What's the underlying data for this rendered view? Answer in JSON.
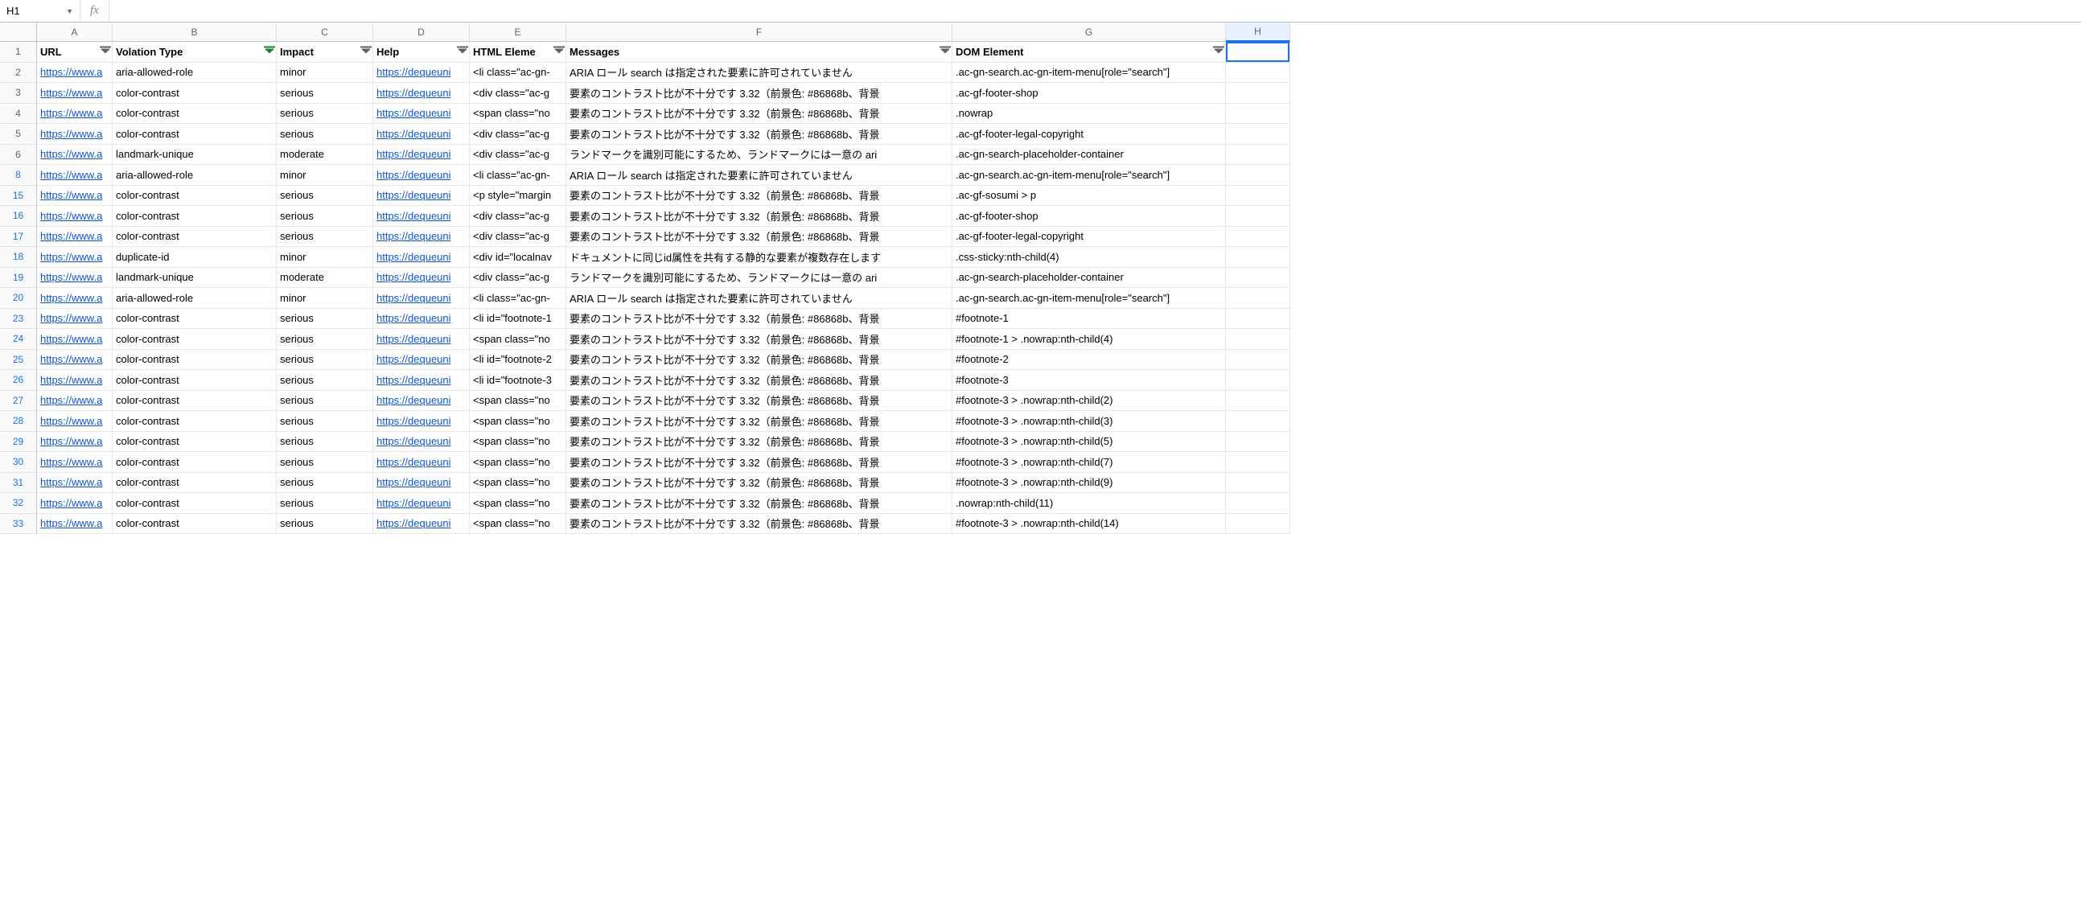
{
  "name_box": "H1",
  "fx_label": "fx",
  "columns": [
    "A",
    "B",
    "C",
    "D",
    "E",
    "F",
    "G",
    "H"
  ],
  "headers": {
    "url": "URL",
    "violation_type": "Volation Type",
    "impact": "Impact",
    "help": "Help",
    "html_element": "HTML Eleme",
    "messages": "Messages",
    "dom_element": "DOM Element"
  },
  "row_numbers": [
    "1",
    "2",
    "3",
    "4",
    "5",
    "6",
    "8",
    "15",
    "16",
    "17",
    "18",
    "19",
    "20",
    "23",
    "24",
    "25",
    "26",
    "27",
    "28",
    "29",
    "30",
    "31",
    "32",
    "33"
  ],
  "filtered_rows": [
    "8",
    "15",
    "16",
    "17",
    "18",
    "19",
    "20",
    "23",
    "24",
    "25",
    "26",
    "27",
    "28",
    "29",
    "30",
    "31",
    "32",
    "33"
  ],
  "rows": [
    {
      "url": "https://www.a",
      "type": "aria-allowed-role",
      "impact": "minor",
      "help": "https://dequeuni",
      "html": "<li class=\"ac-gn-",
      "msg": "ARIA ロール search は指定された要素に許可されていません",
      "dom": ".ac-gn-search.ac-gn-item-menu[role=\"search\"]"
    },
    {
      "url": "https://www.a",
      "type": "color-contrast",
      "impact": "serious",
      "help": "https://dequeuni",
      "html": "<div class=\"ac-g",
      "msg": "要素のコントラスト比が不十分です 3.32（前景色: #86868b、背景",
      "dom": ".ac-gf-footer-shop"
    },
    {
      "url": "https://www.a",
      "type": "color-contrast",
      "impact": "serious",
      "help": "https://dequeuni",
      "html": "<span class=\"no",
      "msg": "要素のコントラスト比が不十分です 3.32（前景色: #86868b、背景",
      "dom": ".nowrap"
    },
    {
      "url": "https://www.a",
      "type": "color-contrast",
      "impact": "serious",
      "help": "https://dequeuni",
      "html": "<div class=\"ac-g",
      "msg": "要素のコントラスト比が不十分です 3.32（前景色: #86868b、背景",
      "dom": ".ac-gf-footer-legal-copyright"
    },
    {
      "url": "https://www.a",
      "type": "landmark-unique",
      "impact": "moderate",
      "help": "https://dequeuni",
      "html": "<div class=\"ac-g",
      "msg": "ランドマークを識別可能にするため、ランドマークには一意の ari",
      "dom": ".ac-gn-search-placeholder-container"
    },
    {
      "url": "https://www.a",
      "type": "aria-allowed-role",
      "impact": "minor",
      "help": "https://dequeuni",
      "html": "<li class=\"ac-gn-",
      "msg": "ARIA ロール search は指定された要素に許可されていません",
      "dom": ".ac-gn-search.ac-gn-item-menu[role=\"search\"]"
    },
    {
      "url": "https://www.a",
      "type": "color-contrast",
      "impact": "serious",
      "help": "https://dequeuni",
      "html": "<p style=\"margin",
      "msg": "要素のコントラスト比が不十分です 3.32（前景色: #86868b、背景",
      "dom": ".ac-gf-sosumi > p"
    },
    {
      "url": "https://www.a",
      "type": "color-contrast",
      "impact": "serious",
      "help": "https://dequeuni",
      "html": "<div class=\"ac-g",
      "msg": "要素のコントラスト比が不十分です 3.32（前景色: #86868b、背景",
      "dom": ".ac-gf-footer-shop"
    },
    {
      "url": "https://www.a",
      "type": "color-contrast",
      "impact": "serious",
      "help": "https://dequeuni",
      "html": "<div class=\"ac-g",
      "msg": "要素のコントラスト比が不十分です 3.32（前景色: #86868b、背景",
      "dom": ".ac-gf-footer-legal-copyright"
    },
    {
      "url": "https://www.a",
      "type": "duplicate-id",
      "impact": "minor",
      "help": "https://dequeuni",
      "html": "<div id=\"localnav",
      "msg": "ドキュメントに同じid属性を共有する静的な要素が複数存在します",
      "dom": ".css-sticky:nth-child(4)"
    },
    {
      "url": "https://www.a",
      "type": "landmark-unique",
      "impact": "moderate",
      "help": "https://dequeuni",
      "html": "<div class=\"ac-g",
      "msg": "ランドマークを識別可能にするため、ランドマークには一意の ari",
      "dom": ".ac-gn-search-placeholder-container"
    },
    {
      "url": "https://www.a",
      "type": "aria-allowed-role",
      "impact": "minor",
      "help": "https://dequeuni",
      "html": "<li class=\"ac-gn-",
      "msg": "ARIA ロール search は指定された要素に許可されていません",
      "dom": ".ac-gn-search.ac-gn-item-menu[role=\"search\"]"
    },
    {
      "url": "https://www.a",
      "type": "color-contrast",
      "impact": "serious",
      "help": "https://dequeuni",
      "html": "<li id=\"footnote-1",
      "msg": "要素のコントラスト比が不十分です 3.32（前景色: #86868b、背景",
      "dom": "#footnote-1"
    },
    {
      "url": "https://www.a",
      "type": "color-contrast",
      "impact": "serious",
      "help": "https://dequeuni",
      "html": "<span class=\"no",
      "msg": "要素のコントラスト比が不十分です 3.32（前景色: #86868b、背景",
      "dom": "#footnote-1 > .nowrap:nth-child(4)"
    },
    {
      "url": "https://www.a",
      "type": "color-contrast",
      "impact": "serious",
      "help": "https://dequeuni",
      "html": "<li id=\"footnote-2",
      "msg": "要素のコントラスト比が不十分です 3.32（前景色: #86868b、背景",
      "dom": "#footnote-2"
    },
    {
      "url": "https://www.a",
      "type": "color-contrast",
      "impact": "serious",
      "help": "https://dequeuni",
      "html": "<li id=\"footnote-3",
      "msg": "要素のコントラスト比が不十分です 3.32（前景色: #86868b、背景",
      "dom": "#footnote-3"
    },
    {
      "url": "https://www.a",
      "type": "color-contrast",
      "impact": "serious",
      "help": "https://dequeuni",
      "html": "<span class=\"no",
      "msg": "要素のコントラスト比が不十分です 3.32（前景色: #86868b、背景",
      "dom": "#footnote-3 > .nowrap:nth-child(2)"
    },
    {
      "url": "https://www.a",
      "type": "color-contrast",
      "impact": "serious",
      "help": "https://dequeuni",
      "html": "<span class=\"no",
      "msg": "要素のコントラスト比が不十分です 3.32（前景色: #86868b、背景",
      "dom": "#footnote-3 > .nowrap:nth-child(3)"
    },
    {
      "url": "https://www.a",
      "type": "color-contrast",
      "impact": "serious",
      "help": "https://dequeuni",
      "html": "<span class=\"no",
      "msg": "要素のコントラスト比が不十分です 3.32（前景色: #86868b、背景",
      "dom": "#footnote-3 > .nowrap:nth-child(5)"
    },
    {
      "url": "https://www.a",
      "type": "color-contrast",
      "impact": "serious",
      "help": "https://dequeuni",
      "html": "<span class=\"no",
      "msg": "要素のコントラスト比が不十分です 3.32（前景色: #86868b、背景",
      "dom": "#footnote-3 > .nowrap:nth-child(7)"
    },
    {
      "url": "https://www.a",
      "type": "color-contrast",
      "impact": "serious",
      "help": "https://dequeuni",
      "html": "<span class=\"no",
      "msg": "要素のコントラスト比が不十分です 3.32（前景色: #86868b、背景",
      "dom": "#footnote-3 > .nowrap:nth-child(9)"
    },
    {
      "url": "https://www.a",
      "type": "color-contrast",
      "impact": "serious",
      "help": "https://dequeuni",
      "html": "<span class=\"no",
      "msg": "要素のコントラスト比が不十分です 3.32（前景色: #86868b、背景",
      "dom": ".nowrap:nth-child(11)"
    },
    {
      "url": "https://www.a",
      "type": "color-contrast",
      "impact": "serious",
      "help": "https://dequeuni",
      "html": "<span class=\"no",
      "msg": "要素のコントラスト比が不十分です 3.32（前景色: #86868b、背景",
      "dom": "#footnote-3 > .nowrap:nth-child(14)"
    }
  ]
}
